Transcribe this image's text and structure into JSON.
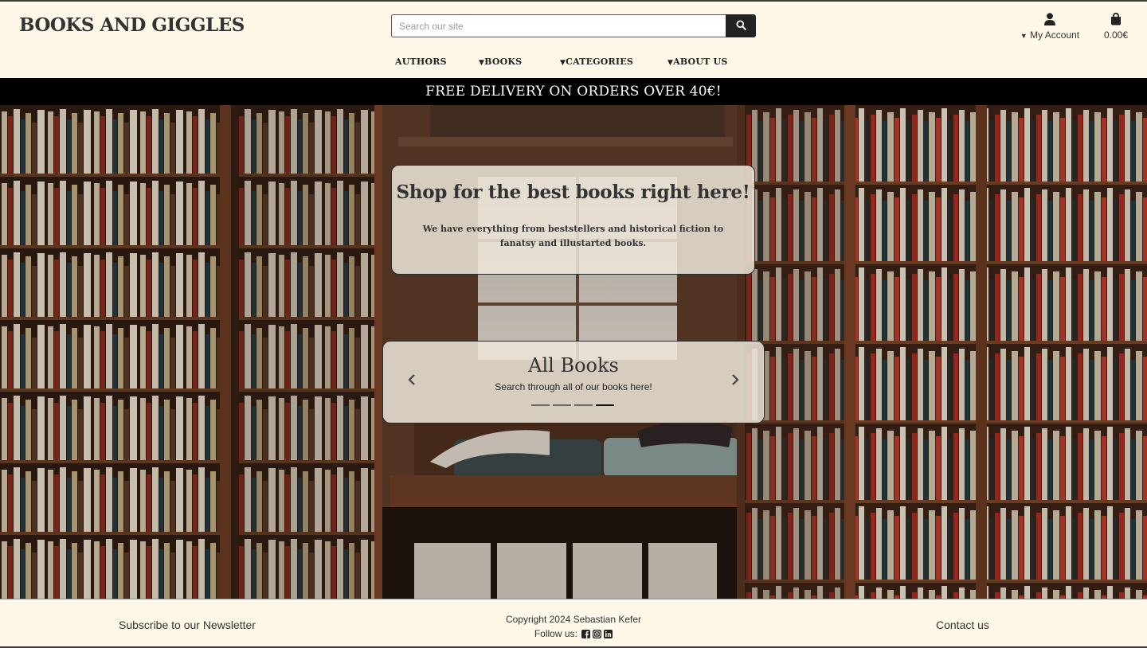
{
  "header": {
    "logo": "BOOKS AND GIGGLES",
    "search": {
      "placeholder": "Search our site",
      "value": ""
    },
    "account_label": "My Account",
    "bag_total": "0.00€"
  },
  "nav": {
    "items": [
      {
        "label": "AUTHORS",
        "caret": ""
      },
      {
        "label": "BOOKS",
        "caret": "▾"
      },
      {
        "label": "CATEGORIES",
        "caret": "▾"
      },
      {
        "label": "ABOUT US",
        "caret": "▾"
      }
    ]
  },
  "banner": {
    "text": "FREE DELIVERY ON ORDERS OVER 40€!"
  },
  "hero": {
    "title": "Shop for the best books right here!",
    "text": "We have everything from beststellers and historical fiction to fanatsy and illustarted books."
  },
  "carousel": {
    "title": "All Books",
    "subtitle": "Search through all of our books here!",
    "slide_count": 4,
    "active_slide": 4
  },
  "footer": {
    "newsletter": "Subscribe to our Newsletter",
    "copyright": "Copyright 2024 Sebastian Kefer",
    "follow_label": "Follow us:",
    "social_icons": [
      "facebook-icon",
      "instagram-icon",
      "linkedin-icon"
    ],
    "contact": "Contact us"
  },
  "colors": {
    "header_bg": "#fff8e8",
    "banner_bg": "#000000",
    "text": "#333333"
  }
}
